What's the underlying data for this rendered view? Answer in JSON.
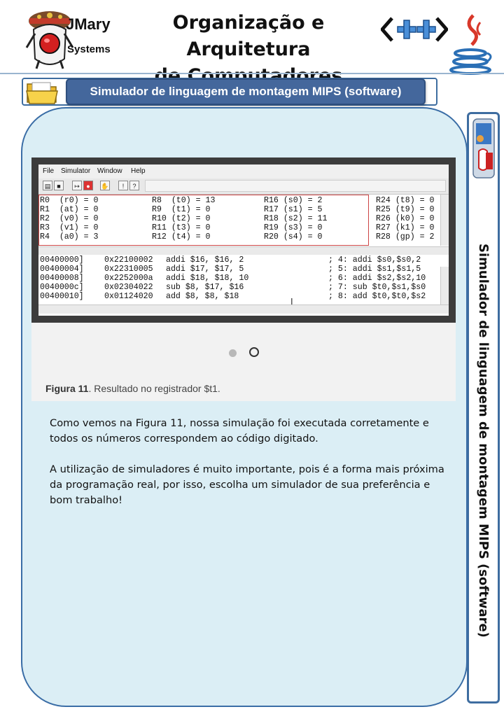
{
  "header": {
    "logo_name": "JMary",
    "logo_sub": "Systems",
    "course_line1": "Organização e Arquitetura",
    "course_line2": "de Computadores",
    "cpp_logo_text": "<++>"
  },
  "banner": {
    "title": "Simulador de linguagem de montagem MIPS (software)"
  },
  "side_tab": {
    "title": "Simulador de linguagem de montagem MIPS (software)"
  },
  "figure": {
    "menu": [
      "File",
      "Simulator",
      "Window",
      "Help"
    ],
    "registers": [
      [
        "R0  (r0) = 0",
        "R8  (t0) = 13",
        "R16 (s0) = 2",
        "R24 (t8) = 0"
      ],
      [
        "R1  (at) = 0",
        "R9  (t1) = 0",
        "R17 (s1) = 5",
        "R25 (t9) = 0"
      ],
      [
        "R2  (v0) = 0",
        "R10 (t2) = 0",
        "R18 (s2) = 11",
        "R26 (k0) = 0"
      ],
      [
        "R3  (v1) = 0",
        "R11 (t3) = 0",
        "R19 (s3) = 0",
        "R27 (k1) = 0"
      ],
      [
        "R4  (a0) = 3",
        "R12 (t4) = 0",
        "R20 (s4) = 0",
        "R28 (gp) = 2"
      ]
    ],
    "code": [
      [
        "00400000]",
        "0x22100002",
        "addi $16, $16, 2",
        "; 4: addi $s0,$s0,2"
      ],
      [
        "00400004]",
        "0x22310005",
        "addi $17, $17, 5",
        "; 5: addi $s1,$s1,5"
      ],
      [
        "00400008]",
        "0x2252000a",
        "addi $18, $18, 10",
        "; 6: addi $s2,$s2,10"
      ],
      [
        "0040000c]",
        "0x02304022",
        "sub $8, $17, $16",
        "; 7: sub $t0,$s1,$s0"
      ],
      [
        "00400010]",
        "0x01124020",
        "add $8, $8, $18",
        "; 8: add $t0,$t0,$s2"
      ]
    ],
    "caption_label": "Figura 11",
    "caption_text": ". Resultado no registrador $t1."
  },
  "body": {
    "paragraph1": "Como vemos na Figura 11, nossa simulação foi executada corretamente e todos os números correspondem ao código digitado.",
    "paragraph2": "A utilização de simuladores é muito importante, pois é a forma mais próxima da programação real, por isso, escolha um simulador de sua preferência e bom trabalho!"
  },
  "colors": {
    "accent_blue": "#44679c",
    "panel_bg": "#dbeef5",
    "panel_border": "#3a6da6"
  }
}
